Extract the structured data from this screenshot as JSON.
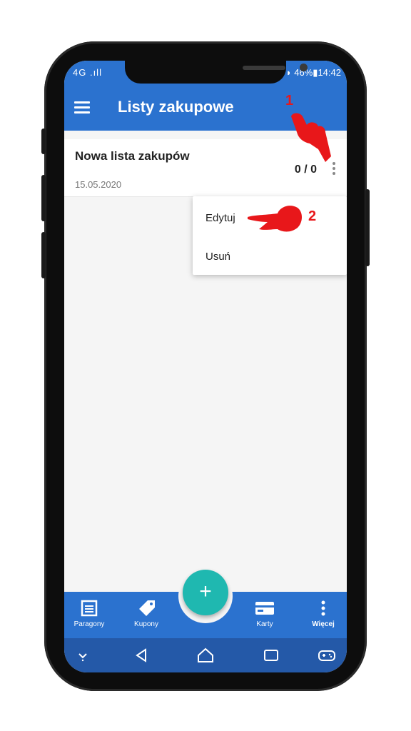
{
  "status": {
    "network": "4G",
    "battery": "46%",
    "time": "14:42"
  },
  "appbar": {
    "title": "Listy zakupowe"
  },
  "list": {
    "name": "Nowa lista zakupów",
    "date": "15.05.2020",
    "count": "0 / 0"
  },
  "menu": {
    "edit": "Edytuj",
    "delete": "Usuń"
  },
  "annotations": {
    "step1": "1",
    "step2": "2"
  },
  "bottom_nav": {
    "receipts": "Paragony",
    "coupons": "Kupony",
    "cards": "Karty",
    "more": "Więcej"
  },
  "fab": {
    "label": "+"
  },
  "colors": {
    "primary": "#2b72cf",
    "accent": "#1fb8b0",
    "annotation": "#e8171a"
  }
}
